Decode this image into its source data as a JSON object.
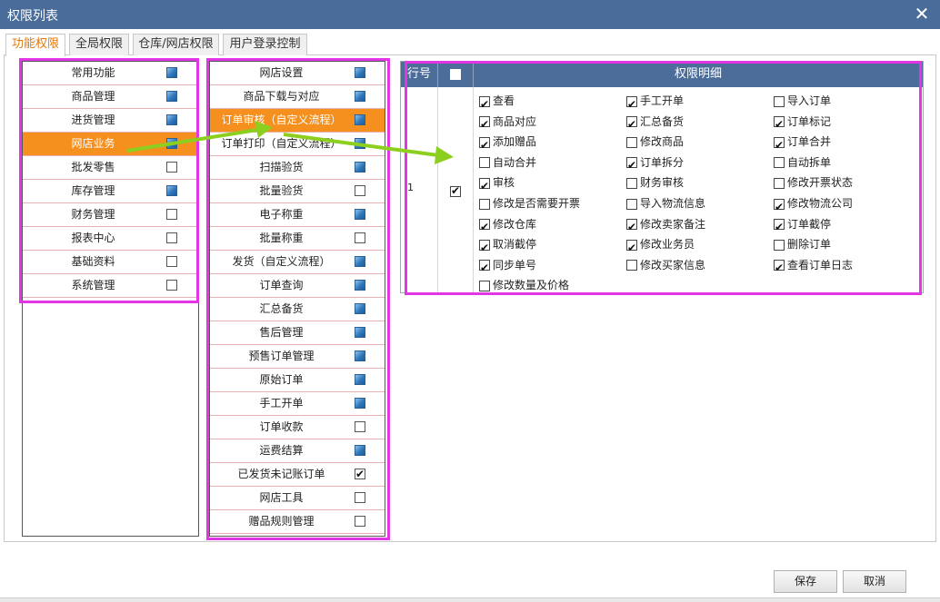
{
  "window": {
    "title": "权限列表",
    "close_glyph": "✕"
  },
  "tabs": [
    {
      "label": "功能权限",
      "active": true
    },
    {
      "label": "全局权限",
      "active": false
    },
    {
      "label": "仓库/网店权限",
      "active": false
    },
    {
      "label": "用户登录控制",
      "active": false
    }
  ],
  "modules": [
    {
      "label": "常用功能",
      "state": "filled"
    },
    {
      "label": "商品管理",
      "state": "filled"
    },
    {
      "label": "进货管理",
      "state": "filled"
    },
    {
      "label": "网店业务",
      "state": "filled",
      "selected": true
    },
    {
      "label": "批发零售",
      "state": "empty"
    },
    {
      "label": "库存管理",
      "state": "filled"
    },
    {
      "label": "财务管理",
      "state": "empty"
    },
    {
      "label": "报表中心",
      "state": "empty"
    },
    {
      "label": "基础资料",
      "state": "empty"
    },
    {
      "label": "系统管理",
      "state": "empty"
    }
  ],
  "functions": [
    {
      "label": "网店设置",
      "state": "filled"
    },
    {
      "label": "商品下载与对应",
      "state": "filled"
    },
    {
      "label": "订单审核（自定义流程）",
      "state": "filled",
      "selected": true
    },
    {
      "label": "订单打印（自定义流程）",
      "state": "filled"
    },
    {
      "label": "扫描验货",
      "state": "filled"
    },
    {
      "label": "批量验货",
      "state": "empty"
    },
    {
      "label": "电子称重",
      "state": "filled"
    },
    {
      "label": "批量称重",
      "state": "empty"
    },
    {
      "label": "发货（自定义流程）",
      "state": "filled"
    },
    {
      "label": "订单查询",
      "state": "filled"
    },
    {
      "label": "汇总备货",
      "state": "filled"
    },
    {
      "label": "售后管理",
      "state": "filled"
    },
    {
      "label": "预售订单管理",
      "state": "filled"
    },
    {
      "label": "原始订单",
      "state": "filled"
    },
    {
      "label": "手工开单",
      "state": "filled"
    },
    {
      "label": "订单收款",
      "state": "empty"
    },
    {
      "label": "运费结算",
      "state": "filled"
    },
    {
      "label": "已发货未记账订单",
      "state": "checked"
    },
    {
      "label": "网店工具",
      "state": "empty"
    },
    {
      "label": "赠品规则管理",
      "state": "empty"
    }
  ],
  "grid": {
    "col_row_no": "行号",
    "col_detail": "权限明细",
    "row_number": "1",
    "row_checked": true,
    "permissions": [
      {
        "label": "查看",
        "checked": true
      },
      {
        "label": "手工开单",
        "checked": true
      },
      {
        "label": "导入订单",
        "checked": false
      },
      {
        "label": "商品对应",
        "checked": true
      },
      {
        "label": "汇总备货",
        "checked": true
      },
      {
        "label": "订单标记",
        "checked": true
      },
      {
        "label": "添加赠品",
        "checked": true
      },
      {
        "label": "修改商品",
        "checked": false
      },
      {
        "label": "订单合并",
        "checked": true
      },
      {
        "label": "自动合并",
        "checked": false
      },
      {
        "label": "订单拆分",
        "checked": true
      },
      {
        "label": "自动拆单",
        "checked": false
      },
      {
        "label": "审核",
        "checked": true
      },
      {
        "label": "财务审核",
        "checked": false
      },
      {
        "label": "修改开票状态",
        "checked": false
      },
      {
        "label": "修改是否需要开票",
        "checked": false
      },
      {
        "label": "导入物流信息",
        "checked": false
      },
      {
        "label": "修改物流公司",
        "checked": true
      },
      {
        "label": "修改仓库",
        "checked": true
      },
      {
        "label": "修改卖家备注",
        "checked": true
      },
      {
        "label": "订单截停",
        "checked": true
      },
      {
        "label": "取消截停",
        "checked": true
      },
      {
        "label": "修改业务员",
        "checked": true
      },
      {
        "label": "删除订单",
        "checked": false
      },
      {
        "label": "同步单号",
        "checked": true
      },
      {
        "label": "修改买家信息",
        "checked": false
      },
      {
        "label": "查看订单日志",
        "checked": true
      },
      {
        "label": "修改数量及价格",
        "checked": false
      }
    ]
  },
  "buttons": {
    "save": "保存",
    "cancel": "取消"
  },
  "colors": {
    "title_bar": "#4a6c9b",
    "selected_row": "#f5901f",
    "annotation_box": "#e135e6",
    "annotation_arrow": "#8ccf1e"
  }
}
